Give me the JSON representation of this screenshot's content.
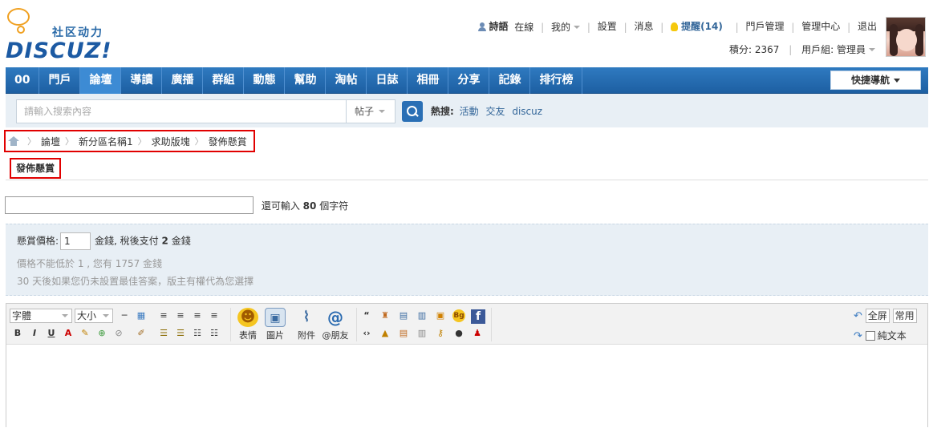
{
  "logo": {
    "cn": "社区动力",
    "en": "DISCUZ!"
  },
  "user_menu": {
    "username": "詩語",
    "status": "在線",
    "mine": "我的",
    "settings": "設置",
    "messages": "消息",
    "remind": "提醒(14)",
    "portal_manage": "門戶管理",
    "admin_center": "管理中心",
    "logout": "退出"
  },
  "user_info": {
    "credits": "積分: 2367",
    "group": "用戶組: 管理員"
  },
  "nav": {
    "items": [
      "00",
      "門戶",
      "論壇",
      "導讀",
      "廣播",
      "群組",
      "動態",
      "幫助",
      "淘帖",
      "日誌",
      "相冊",
      "分享",
      "記錄",
      "排行榜"
    ],
    "active": "論壇",
    "quick_nav": "快捷導航"
  },
  "search": {
    "placeholder": "請輸入搜索內容",
    "type": "帖子",
    "hot_label": "熱搜:",
    "hot_terms": [
      "活動",
      "交友",
      "discuz"
    ]
  },
  "breadcrumb": [
    "論壇",
    "新分區名稱1",
    "求助版塊",
    "發佈懸賞"
  ],
  "tab": {
    "label": "發佈懸賞"
  },
  "title_row": {
    "remain_prefix": "還可輸入",
    "remain_count": "80",
    "remain_suffix": "個字符"
  },
  "reward": {
    "price_label": "懸賞價格:",
    "price_value": "1",
    "after_price": "金錢, 稅後支付",
    "tax_value": "2",
    "tax_unit": "金錢",
    "note1": "價格不能低於 1 , 您有 1757 金錢",
    "note2": "30 天後如果您仍未設置最佳答案，版主有權代為您選擇"
  },
  "editor": {
    "font_select": "字體",
    "size_select": "大小",
    "emoji": "表情",
    "image": "圖片",
    "attach": "附件",
    "at_friend": "@朋友",
    "fullscreen": "全屏",
    "common": "常用",
    "plaintext": "純文本"
  },
  "colors": {
    "nav": "#2a6fb5",
    "nav_active": "#3d8bd4",
    "link": "#336699",
    "highlight_border": "#e10000",
    "panel_bg": "#e8eff5"
  }
}
